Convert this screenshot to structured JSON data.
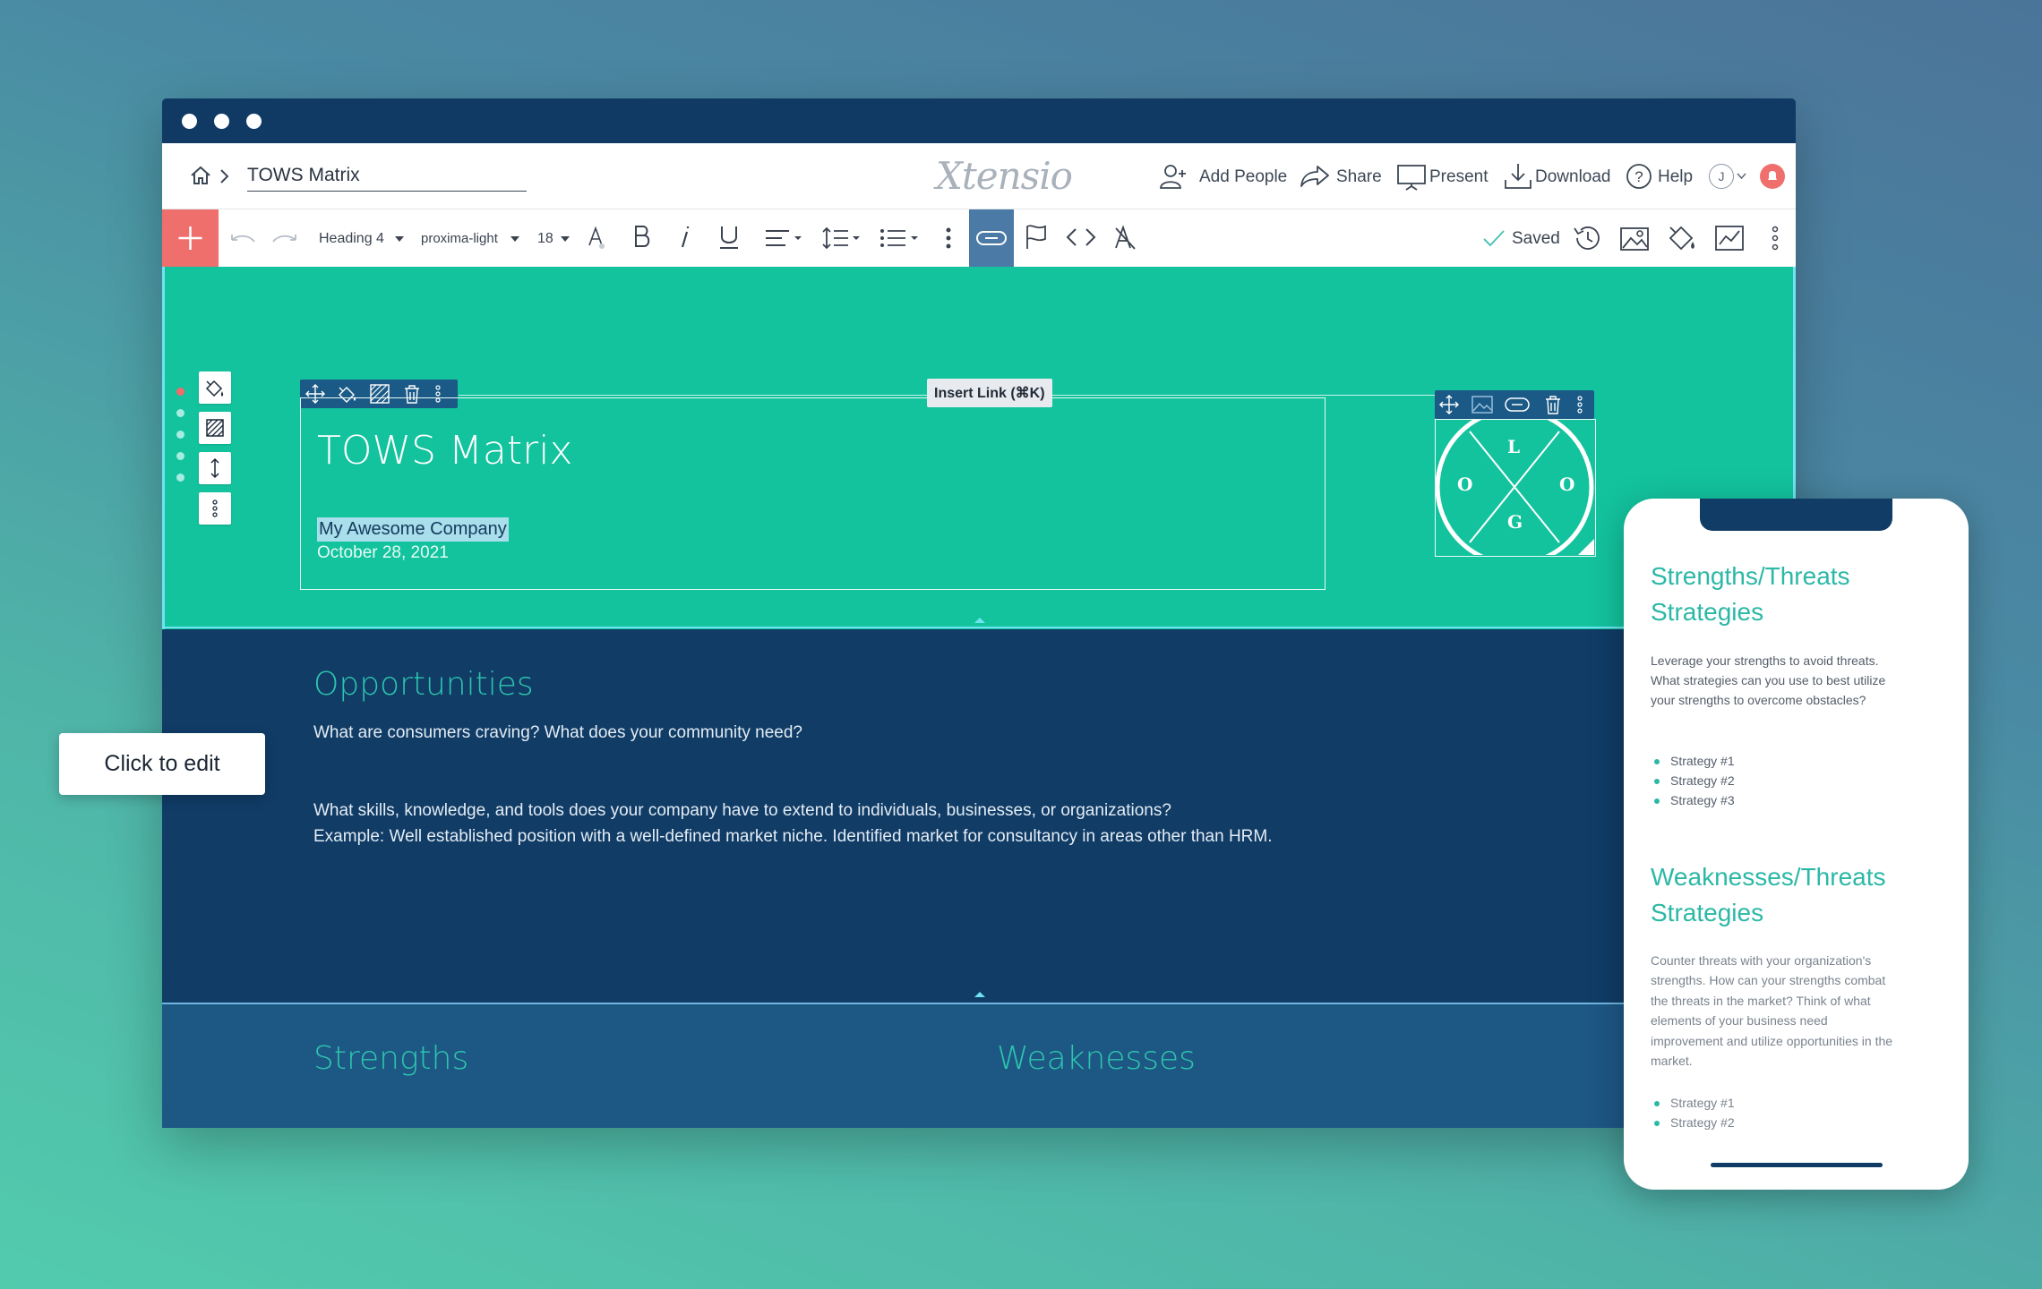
{
  "nav": {
    "doc_title": "TOWS Matrix",
    "brand": "Xtensio",
    "add_people": "Add People",
    "share": "Share",
    "present": "Present",
    "download": "Download",
    "help": "Help",
    "avatar_initial": "J"
  },
  "toolbar": {
    "block_style": "Heading 4",
    "font": "proxima-light",
    "font_size": "18",
    "saved": "Saved",
    "tooltip": "Insert Link (⌘K)"
  },
  "hero": {
    "title": "TOWS Matrix",
    "company": "My Awesome Company",
    "date": "October 28, 2021",
    "logo_letters": [
      "L",
      "O",
      "O",
      "G"
    ]
  },
  "opportunities": {
    "heading": "Opportunities",
    "question": "What are consumers craving? What does your community need?",
    "line1": "What skills, knowledge, and tools does your company have to extend to individuals, businesses, or organizations?",
    "line2": "Example: Well established position with a well-defined market niche. Identified market for consultancy in areas other than HRM."
  },
  "bottom": {
    "strengths": "Strengths",
    "weaknesses": "Weaknesses"
  },
  "click_to_edit": "Click to edit",
  "phone": {
    "st_heading_1": "Strengths/Threats",
    "st_heading_2": "Strategies",
    "st_body_1": "Leverage your strengths to avoid threats.",
    "st_body_2": "What strategies can you use to best utilize",
    "st_body_3": "your strengths to overcome obstacles?",
    "st_list": [
      "Strategy #1",
      "Strategy #2",
      "Strategy #3"
    ],
    "wt_heading_1": "Weaknesses/Threats",
    "wt_heading_2": "Strategies",
    "wt_body": [
      "Counter threats with your organization's",
      "strengths. How can your strengths combat",
      "the threats in the market? Think of what",
      "elements of your business need",
      "improvement and utilize opportunities in the",
      "market."
    ],
    "wt_list": [
      "Strategy #1",
      "Strategy #2"
    ]
  },
  "colors": {
    "hero_bg": "#13c39e",
    "navy": "#103c66",
    "accent_teal": "#2cb8a6",
    "add_button": "#ef6f6c",
    "link_active": "#4b7aa6"
  }
}
